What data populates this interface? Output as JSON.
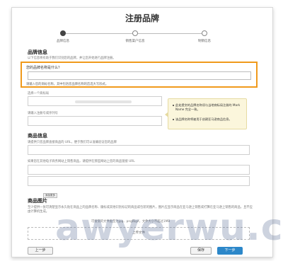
{
  "dialog": {
    "title": "注册品牌",
    "steps": [
      "品牌信息",
      "销售渠户信息",
      "制销信息"
    ],
    "active_step": 0
  },
  "brand_info": {
    "heading": "品牌信息",
    "note": "以下信息将有助于我们识别您的品牌，并让您开始进行品牌注册。",
    "question": "您的品牌名称是什么？",
    "input_value": "",
    "hint": "请输入您的商标名称，其中包括您品牌名称的首选大写形式。",
    "trademark_label": "选择一个商标局",
    "trademark_number_label": "请输入注册号或序列号"
  },
  "tooltip": {
    "items": [
      "此处提交的品牌名称须与当地商标局注册的 Mark Name 完全一致。",
      "该品牌名称将被用于创建亚马逊商品信息。"
    ]
  },
  "product_info": {
    "heading": "商品信息",
    "note1": "请提供只您品牌直接商品的 URL，便于我们可以准确验证您的品牌",
    "note2": "如果您在其他电子商务网站上销售商品，请提供在那些网站上您的商品链接 URL",
    "add_button": "添加更多"
  },
  "images": {
    "heading": "商品图片",
    "note": "至少提供一张可清楚显示永久贴在商品上的品牌名称、徽标或其他识别标记的商品或包装的图片，图片应显示商品在亚马逊上销售或打算在亚马逊上销售的商品，且不应由计算机生成。",
    "formats": "可接受的文件类型为jpg、png和gif，文件大小不超过1MB",
    "upload_text": "上传文件"
  },
  "footer": {
    "back": "上一步",
    "save": "保存",
    "next": "下一步"
  },
  "watermark": "awyerwu.com"
}
